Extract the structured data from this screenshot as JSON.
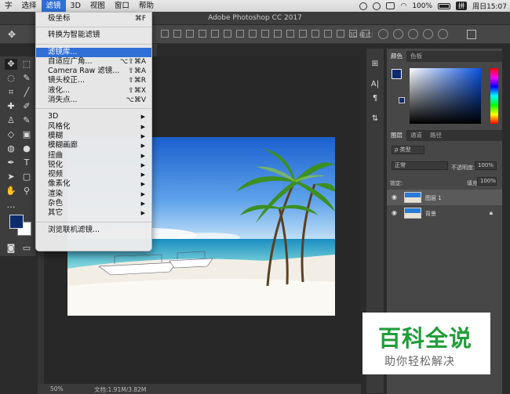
{
  "menubar": {
    "items": [
      "字",
      "选择",
      "滤镜",
      "3D",
      "视图",
      "窗口",
      "帮助"
    ],
    "active_index": 2,
    "battery_text": "100%",
    "ime_label": "拼",
    "clock": "周日15:07"
  },
  "window": {
    "title": "Adobe Photoshop CC 2017"
  },
  "options_bar": {
    "mode_3d_label": "3D 模式:"
  },
  "filter_menu": {
    "items": [
      {
        "label": "极坐标",
        "shortcut": "⌘F"
      },
      {
        "sep": true
      },
      {
        "label": "转换为智能滤镜",
        "shortcut": ""
      },
      {
        "sep": true
      },
      {
        "label": "滤镜库...",
        "shortcut": "",
        "highlighted": true
      },
      {
        "label": "自适应广角...",
        "shortcut": "⌥⇧⌘A"
      },
      {
        "label": "Camera Raw 滤镜...",
        "shortcut": "⇧⌘A"
      },
      {
        "label": "镜头校正...",
        "shortcut": "⇧⌘R"
      },
      {
        "label": "液化...",
        "shortcut": "⇧⌘X"
      },
      {
        "label": "消失点...",
        "shortcut": "⌥⌘V"
      },
      {
        "sep": true
      },
      {
        "label": "3D",
        "submenu": true
      },
      {
        "label": "风格化",
        "submenu": true
      },
      {
        "label": "模糊",
        "submenu": true
      },
      {
        "label": "模糊画廊",
        "submenu": true
      },
      {
        "label": "扭曲",
        "submenu": true
      },
      {
        "label": "锐化",
        "submenu": true
      },
      {
        "label": "视频",
        "submenu": true
      },
      {
        "label": "像素化",
        "submenu": true
      },
      {
        "label": "渲染",
        "submenu": true
      },
      {
        "label": "杂色",
        "submenu": true
      },
      {
        "label": "其它",
        "submenu": true
      },
      {
        "sep": true
      },
      {
        "label": "浏览联机滤镜...",
        "shortcut": ""
      }
    ]
  },
  "status_bar": {
    "zoom": "50%",
    "doc_size": "文档:1.91M/3.82M"
  },
  "color_panel": {
    "tabs": [
      "颜色",
      "色板"
    ],
    "fg_color": "#0c2c6e"
  },
  "layers_panel": {
    "tabs": [
      "图层",
      "通道",
      "路径"
    ],
    "filter_label": "ρ 类型",
    "blend_mode": "正常",
    "opacity_label": "不透明度:",
    "opacity_value": "100%",
    "lock_label": "锁定:",
    "fill_label": "填充:",
    "fill_value": "100%",
    "layers": [
      {
        "name": "图层 1",
        "selected": true,
        "locked": false
      },
      {
        "name": "背景",
        "selected": false,
        "locked": true
      }
    ]
  },
  "watermark": {
    "title": "百科全说",
    "subtitle": "助你轻松解决"
  }
}
